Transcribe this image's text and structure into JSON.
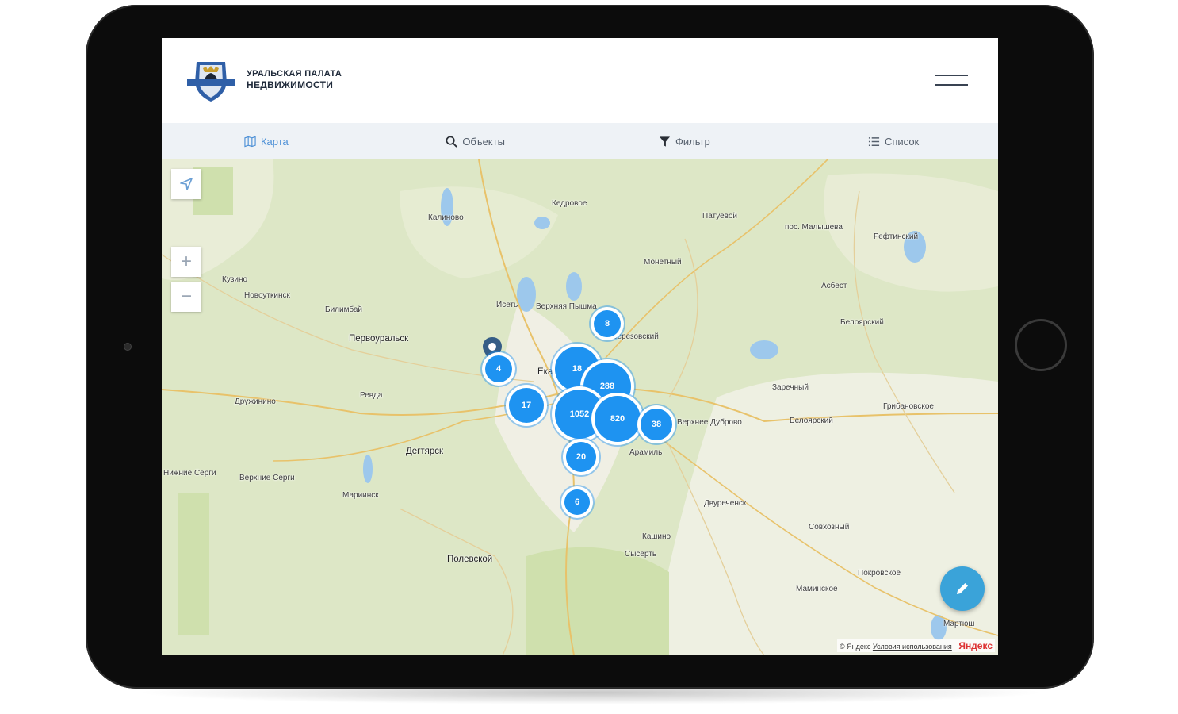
{
  "brand": {
    "line1": "УРАЛЬСКАЯ ПАЛАТА",
    "line2": "НЕДВИЖИМОСТИ"
  },
  "tabs": [
    {
      "label": "Карта",
      "icon": "map-icon",
      "active": true
    },
    {
      "label": "Объекты",
      "icon": "search-icon",
      "active": false
    },
    {
      "label": "Фильтр",
      "icon": "filter-icon",
      "active": false
    },
    {
      "label": "Список",
      "icon": "list-icon",
      "active": false
    }
  ],
  "map": {
    "zoom_in": "+",
    "zoom_out": "−",
    "places": [
      "Кедровое",
      "Калиново",
      "Патуевой",
      "пос. Малышева",
      "Рефтинский",
      "Монетный",
      "Асбест",
      "Кузино",
      "Новоуткинск",
      "Билимбай",
      "Первоуральск",
      "Исеть",
      "Верхняя Пышма",
      "Березовский",
      "Белоярский",
      "Заречный",
      "Ревда",
      "Дружинино",
      "Екатеринбург",
      "Верхнее Дуброво",
      "Белоярский",
      "Грибановское",
      "Дегтярск",
      "Арамиль",
      "Нижние Серги",
      "Верхние Серги",
      "Мариинск",
      "Двуреченск",
      "Совхозный",
      "Кашино",
      "Сысерть",
      "Полевской",
      "Покровское",
      "Маминское",
      "Мартюш"
    ],
    "clusters": [
      "8",
      "4",
      "18",
      "288",
      "17",
      "1052",
      "820",
      "38",
      "20",
      "6"
    ],
    "copyright": "© Яндекс",
    "terms_link": "Условия использования",
    "provider": "Яндекс"
  },
  "colors": {
    "accent": "#1e93f1",
    "fab": "#3aa3d9",
    "tab_active": "#4b8fd6"
  }
}
